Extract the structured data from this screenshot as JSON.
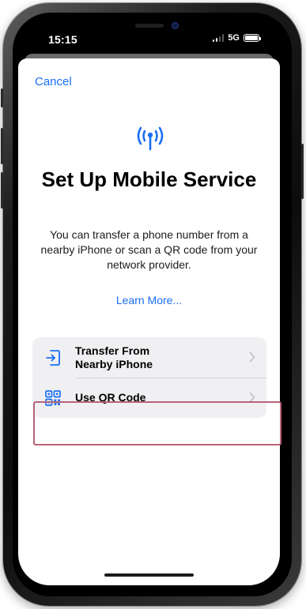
{
  "status_bar": {
    "time": "15:15",
    "network": "5G"
  },
  "sheet": {
    "cancel_label": "Cancel",
    "title": "Set Up Mobile Service",
    "description": "You can transfer a phone number from a nearby iPhone or scan a QR code from your network provider.",
    "learn_more_label": "Learn More..."
  },
  "options": [
    {
      "label": "Transfer From Nearby iPhone",
      "icon": "transfer-icon"
    },
    {
      "label": "Use QR Code",
      "icon": "qr-code-icon"
    }
  ],
  "colors": {
    "accent": "#1a6ff2",
    "highlight": "#b86377",
    "list_background": "#f0f0f3"
  }
}
